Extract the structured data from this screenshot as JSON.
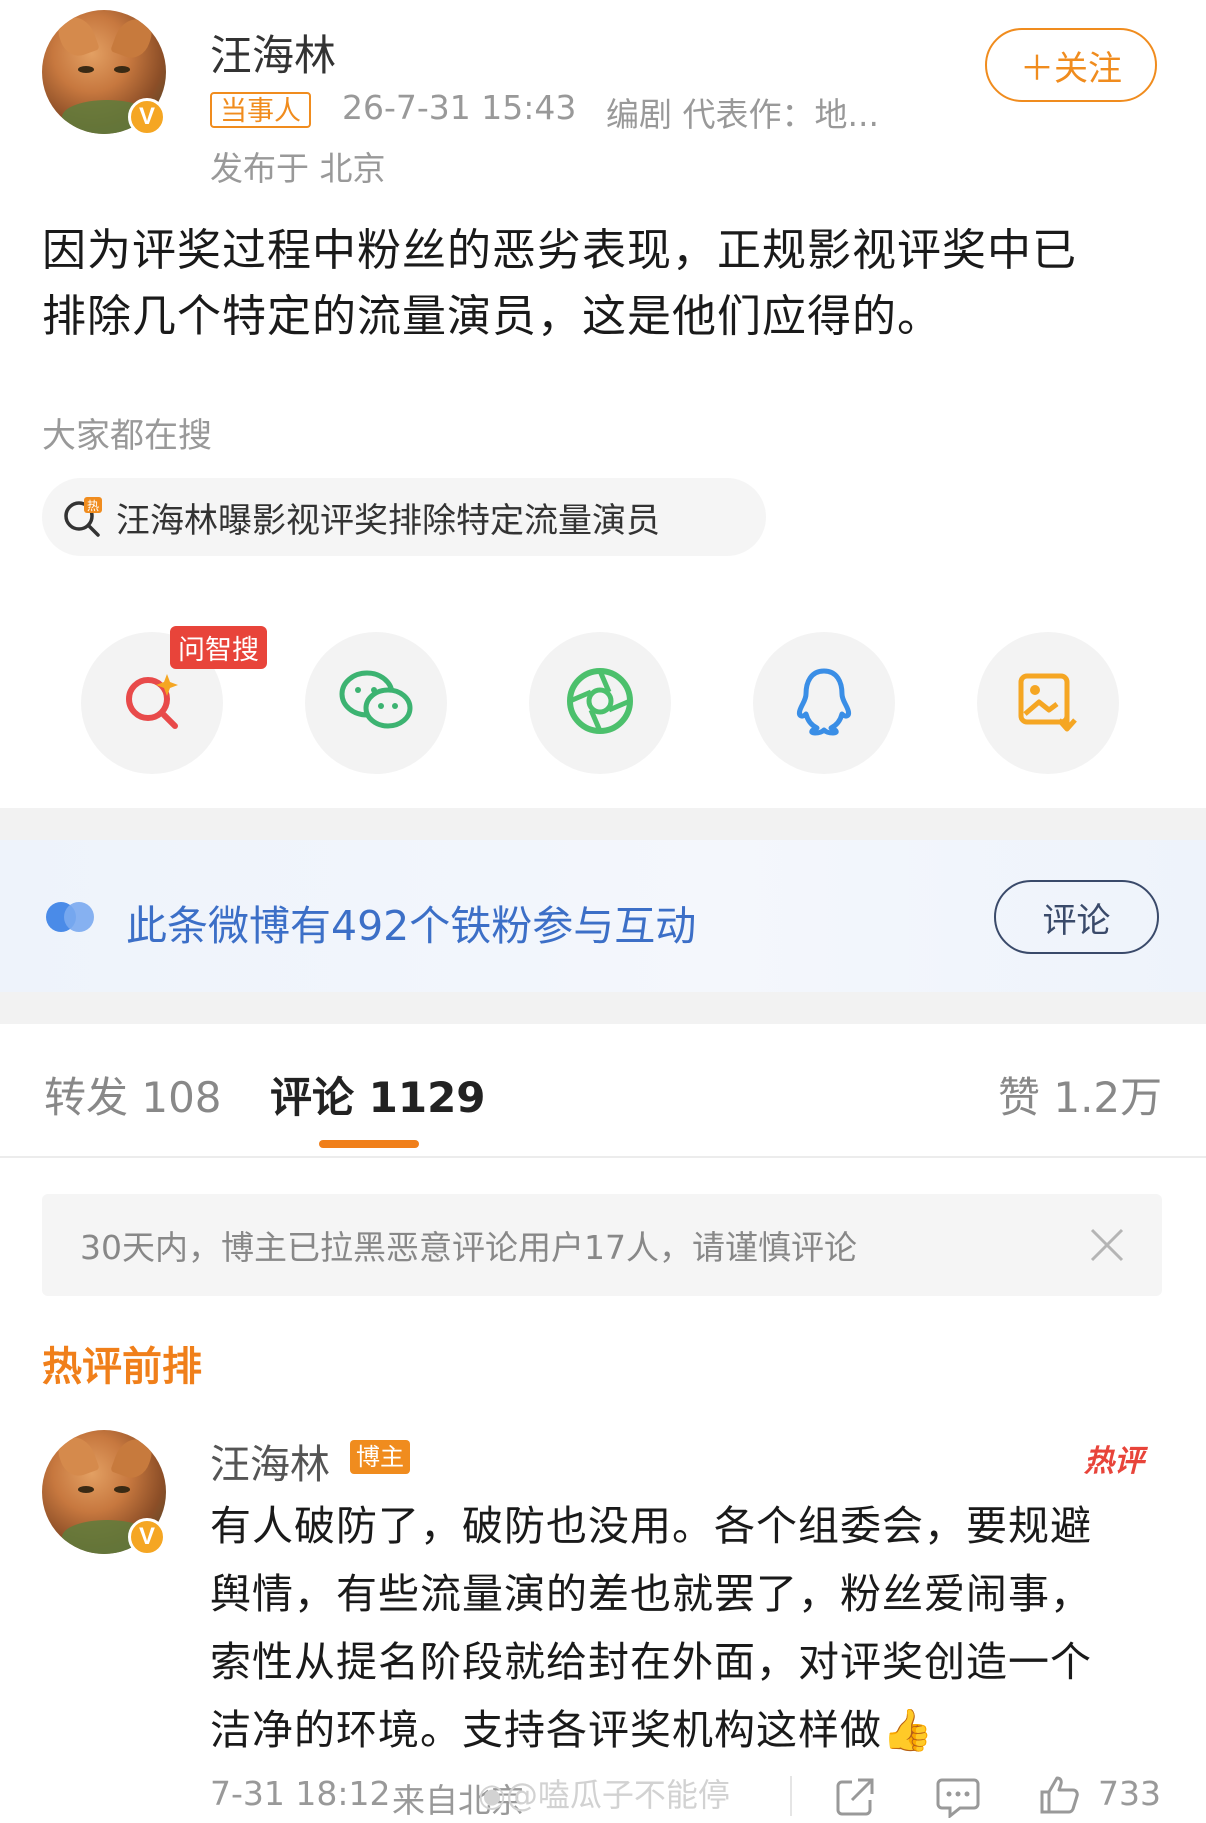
{
  "post": {
    "author": "汪海林",
    "party_tag": "当事人",
    "timestamp": "26-7-31 15:43",
    "author_desc": "编剧 代表作：地...",
    "location": "发布于 北京",
    "follow_label": "＋关注",
    "content_line1": "因为评奖过程中粉丝的恶劣表现，正规影视评奖中已",
    "content_line2": "排除几个特定的流量演员，这是他们应得的。"
  },
  "search": {
    "label": "大家都在搜",
    "hot_topic": "汪海林曝影视评奖排除特定流量演员"
  },
  "share": {
    "ai_badge": "问智搜",
    "items": [
      "search-ai-icon",
      "wechat-icon",
      "moments-icon",
      "qq-icon",
      "save-image-icon"
    ]
  },
  "fans": {
    "text": "此条微博有492个铁粉参与互动",
    "button": "评论"
  },
  "tabs": {
    "repost": "转发 108",
    "comment": "评论 1129",
    "like": "赞 1.2万"
  },
  "notice": {
    "text": "30天内，博主已拉黑恶意评论用户17人，请谨慎评论"
  },
  "hot_comments": {
    "title": "热评前排",
    "first": {
      "author": "汪海林",
      "tag": "博主",
      "hot_label": "热评",
      "line1": "有人破防了，破防也没用。各个组委会，要规避",
      "line2": "舆情，有些流量演的差也就罢了，粉丝爱闹事，",
      "line3": "索性从提名阶段就给封在外面，对评奖创造一个",
      "line4": "洁净的环境。支持各评奖机构这样做",
      "emoji": "👍",
      "time": "7-31 18:12",
      "source": "来自北京",
      "likes": "733"
    }
  },
  "watermark": "@嗑瓜子不能停",
  "colors": {
    "accent_orange": "#f08c1e",
    "link_blue": "#3c6fc7",
    "hot_red": "#e8443a"
  }
}
